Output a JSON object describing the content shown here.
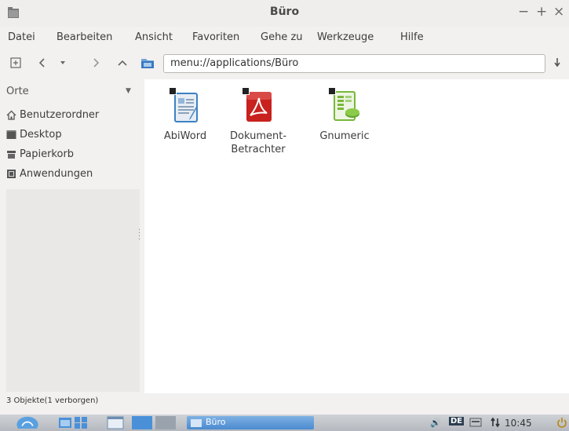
{
  "window": {
    "title": "Büro",
    "controls": {
      "minimize": "−",
      "maximize": "+",
      "close": "×"
    }
  },
  "menubar": {
    "items": [
      "Datei",
      "Bearbeiten",
      "Ansicht",
      "Favoriten",
      "Gehe zu",
      "Werkzeuge",
      "Hilfe"
    ]
  },
  "toolbar": {
    "location": "menu://applications/Büro",
    "icons": [
      "new-tab-icon",
      "back-icon",
      "history-dropdown-icon",
      "forward-icon",
      "up-icon",
      "folder-icon",
      "go-icon"
    ]
  },
  "sidepane": {
    "header": "Orte",
    "places": [
      {
        "label": "Benutzerordner",
        "icon": "home-icon"
      },
      {
        "label": "Desktop",
        "icon": "desktop-icon"
      },
      {
        "label": "Papierkorb",
        "icon": "trash-icon"
      },
      {
        "label": "Anwendungen",
        "icon": "applications-icon"
      }
    ]
  },
  "files": [
    {
      "label": "AbiWord",
      "icon": "abiword-icon"
    },
    {
      "label": "Dokument-\nBetrachter",
      "icon": "pdf-viewer-icon"
    },
    {
      "label": "Gnumeric",
      "icon": "gnumeric-icon"
    }
  ],
  "statusbar": {
    "text": "3 Objekte(1 verborgen)"
  },
  "taskbar": {
    "task_label": "Büro",
    "keyboard_layout": "DE",
    "clock": "10:45"
  },
  "colors": {
    "window_bg": "#f2f1f0",
    "file_area_bg": "#ffffff",
    "abiword_blue": "#3b82c4",
    "pdf_red": "#c8211e",
    "gnumeric_green": "#79b83a",
    "taskbar_blue": "#4a90d9"
  }
}
